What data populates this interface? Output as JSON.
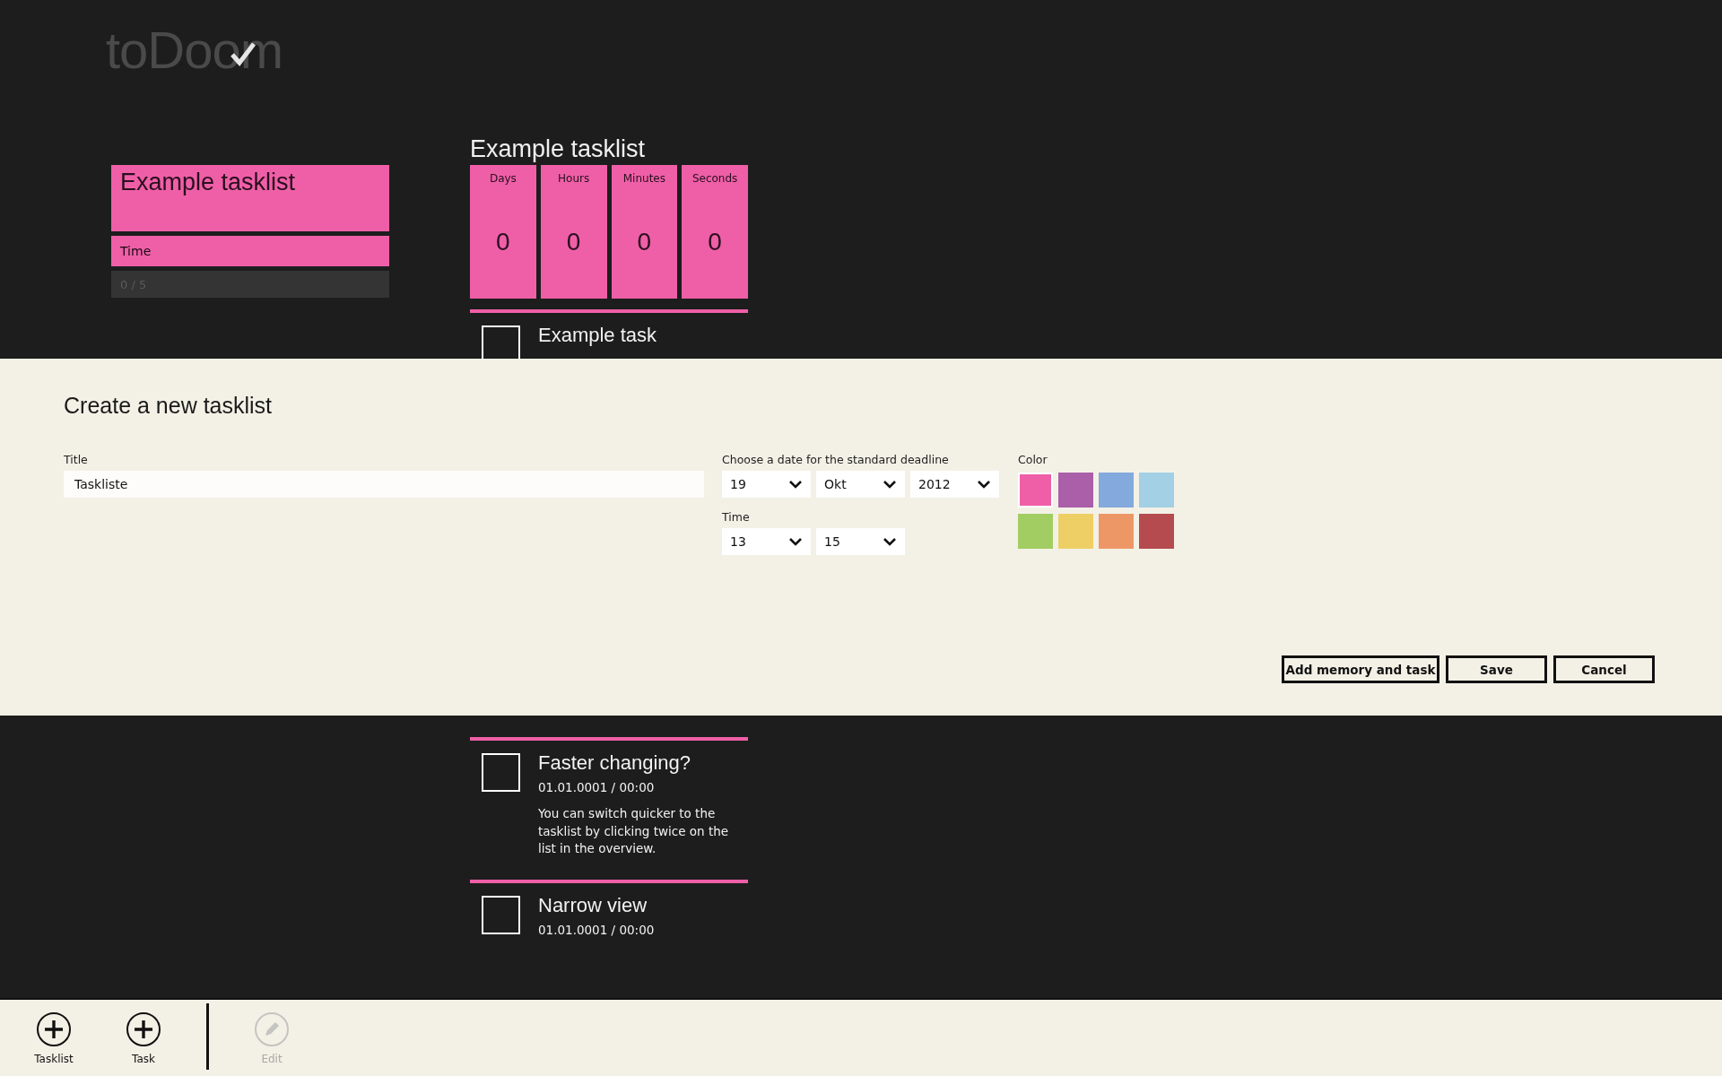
{
  "logo": {
    "text": "toDoom"
  },
  "tasklists": [
    {
      "title": "Example tasklist",
      "time_label": "Time",
      "progress": "0 / 5",
      "level": 0
    }
  ],
  "detail": {
    "title": "Example tasklist",
    "countdown": [
      {
        "label": "Days",
        "value": "0"
      },
      {
        "label": "Hours",
        "value": "0"
      },
      {
        "label": "Minutes",
        "value": "0"
      },
      {
        "label": "Seconds",
        "value": "0"
      }
    ],
    "tasks": [
      {
        "title": "Example task",
        "checked": false
      },
      {
        "title": "Faster changing?",
        "date": "01.01.0001 / 00:00",
        "note": "You can switch quicker to the tasklist by clicking twice on the list in the overview.",
        "checked": false
      },
      {
        "title": "Narrow view",
        "date": "01.01.0001 / 00:00",
        "checked": false
      }
    ]
  },
  "panel": {
    "title": "Create a new tasklist",
    "title_label": "Title",
    "title_value": "Taskliste",
    "date_label": "Choose a date for the standard deadline",
    "day": "19",
    "month": "Okt",
    "year": "2012",
    "time_label": "Time",
    "hour": "13",
    "minute": "15",
    "color_label": "Color",
    "colors": [
      {
        "color": "#ef5fa7",
        "selected": true
      },
      {
        "color": "#aa5fa8",
        "selected": false
      },
      {
        "color": "#84a9dd",
        "selected": false
      },
      {
        "color": "#a3d0e4",
        "selected": false
      },
      {
        "color": "#a2cd63",
        "selected": false
      },
      {
        "color": "#eecf65",
        "selected": false
      },
      {
        "color": "#ee9766",
        "selected": false
      },
      {
        "color": "#b54a4f",
        "selected": false
      }
    ],
    "buttons": [
      "Add memory and task",
      "Save",
      "Cancel"
    ]
  },
  "app_bar": [
    {
      "label": "Tasklist",
      "kind": "add",
      "disabled": false
    },
    {
      "label": "Task",
      "kind": "add",
      "disabled": false
    },
    {
      "label": "Edit",
      "kind": "edit",
      "disabled": true
    }
  ]
}
